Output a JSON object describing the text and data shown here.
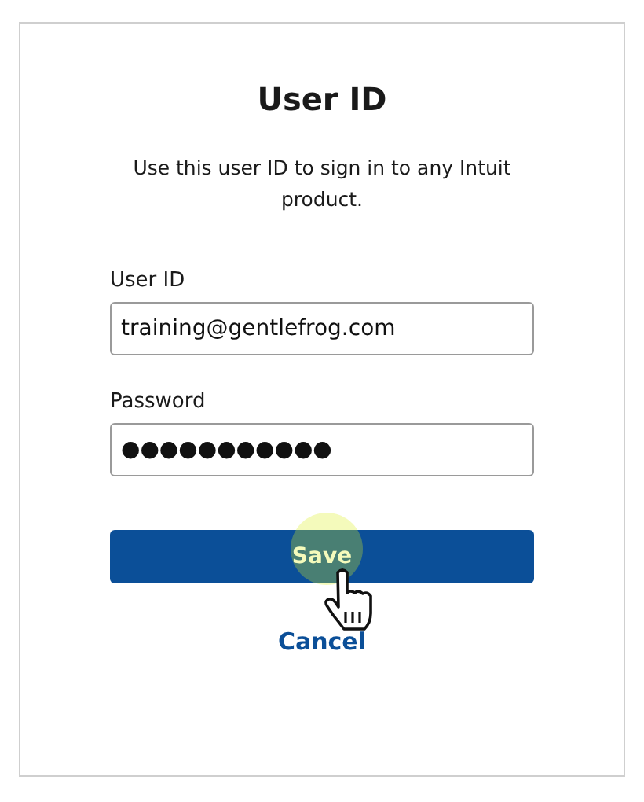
{
  "title": "User ID",
  "description": "Use this user ID to sign in to any Intuit product.",
  "fields": [
    {
      "label": "User ID",
      "value": "training@gentlefrog.com"
    },
    {
      "label": "Password",
      "value": "●●●●●●●●●●●"
    }
  ],
  "save_button": "Save",
  "cancel_link": "Cancel"
}
